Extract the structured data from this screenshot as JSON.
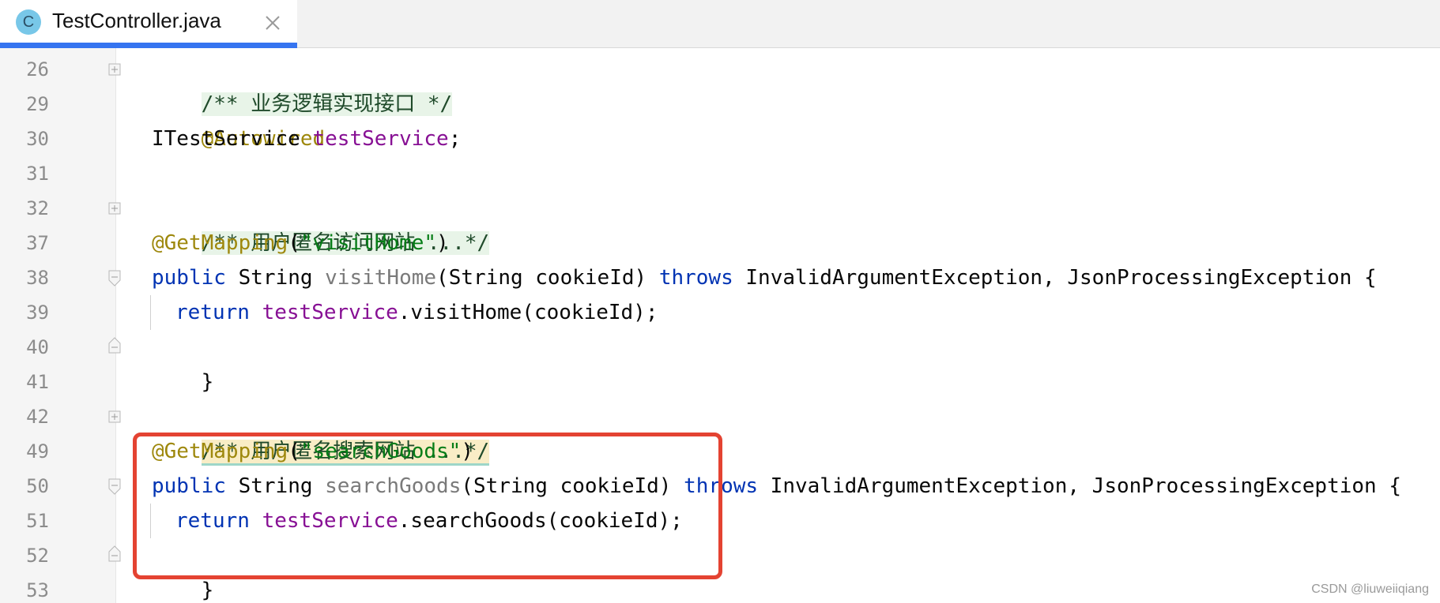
{
  "tab": {
    "icon_letter": "C",
    "filename": "TestController.java",
    "close_icon": "close-icon"
  },
  "gutter": {
    "line_numbers": [
      "26",
      "29",
      "30",
      "31",
      "32",
      "37",
      "38",
      "39",
      "40",
      "41",
      "42",
      "49",
      "50",
      "51",
      "52",
      "53"
    ]
  },
  "code": {
    "l26": {
      "comment": "/** 业务逻辑实现接口 */"
    },
    "l29": {
      "annotation": "@Autowired"
    },
    "l30": {
      "type": "ITestService ",
      "field": "testService",
      "rest": ";"
    },
    "l32": {
      "comment": "/** 用户匿名访问网站 ...*/"
    },
    "l37": {
      "annotation": "@GetMapping",
      "open": "(",
      "string": "\"visitHome\"",
      "close": ")"
    },
    "l38": {
      "kw": "public",
      "sp1": " String ",
      "method": "visitHome",
      "params": "(String cookieId) ",
      "throws": "throws",
      "rest": " InvalidArgumentException, JsonProcessingException {"
    },
    "l39": {
      "kw": "return",
      "sp": " ",
      "field": "testService",
      "rest": ".visitHome(cookieId);"
    },
    "l40": {
      "brace": "}"
    },
    "l42": {
      "comment": "/** 用户匿名搜索网站 ...*/"
    },
    "l49": {
      "annotation": "@GetMapping",
      "open": "(",
      "string": "\"searchGoods\"",
      "close": ")"
    },
    "l50": {
      "kw": "public",
      "sp1": " String ",
      "method": "searchGoods",
      "params": "(String cookieId) ",
      "throws": "throws",
      "rest": " InvalidArgumentException, JsonProcessingException {"
    },
    "l51": {
      "kw": "return",
      "sp": " ",
      "field": "testService",
      "rest": ".searchGoods(cookieId);"
    },
    "l52": {
      "brace": "}"
    }
  },
  "watermark": "CSDN @liuweiiqiang",
  "colors": {
    "tab_accent": "#3574f0",
    "highlight_box": "#e44332",
    "keyword": "#0033b3",
    "annotation": "#9e880d",
    "string": "#067d17",
    "field": "#871094"
  }
}
